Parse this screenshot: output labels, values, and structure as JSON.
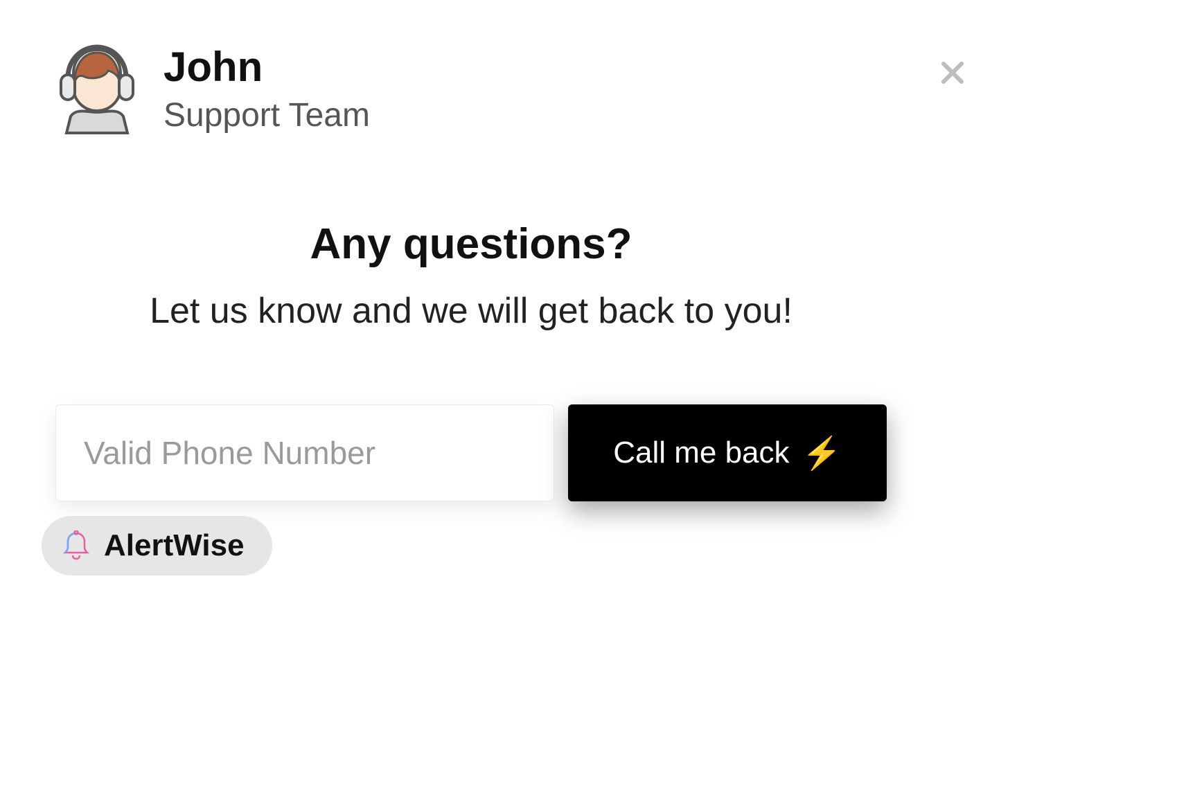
{
  "agent": {
    "name": "John",
    "role": "Support Team"
  },
  "message": {
    "title": "Any questions?",
    "subtitle": "Let us know and we will get back to you!"
  },
  "form": {
    "phone_placeholder": "Valid Phone Number",
    "phone_value": "",
    "call_button_label": "Call me back"
  },
  "badge": {
    "brand": "AlertWise"
  },
  "icons": {
    "close": "close-icon",
    "bolt": "⚡",
    "bell": "bell-icon",
    "avatar": "support-agent-avatar-icon"
  }
}
